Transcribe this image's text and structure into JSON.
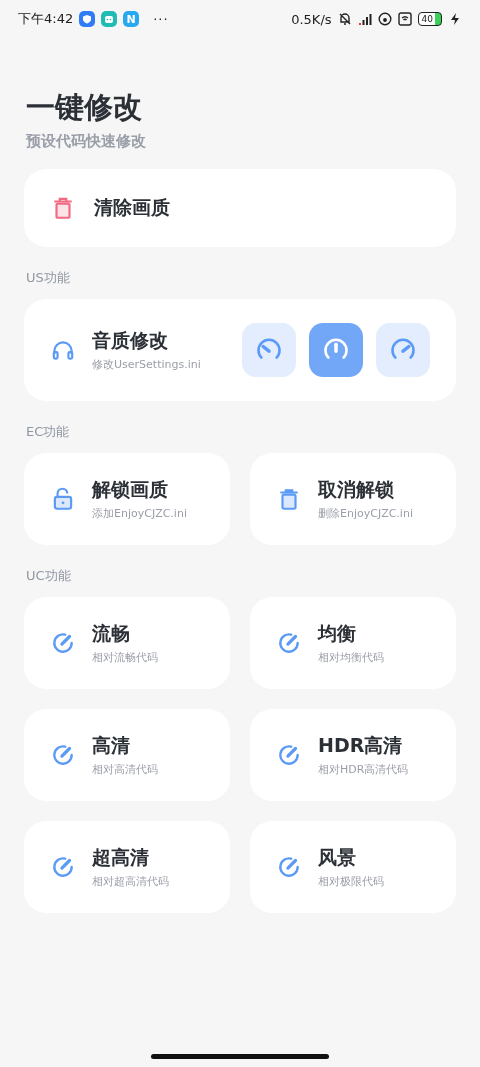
{
  "status_bar": {
    "time": "下午4:42",
    "apps": [
      {
        "color": "#2f7cf6",
        "kind": "shield"
      },
      {
        "color": "#1fbcb4",
        "kind": "bot"
      },
      {
        "color": "#27a8f0",
        "kind": "letter",
        "text": "N"
      }
    ],
    "more": "···",
    "speed": "0.5K/s",
    "battery": "40"
  },
  "header": {
    "title": "一键修改",
    "subtitle": "预设代码快速修改"
  },
  "clear_card": {
    "label": "清除画质"
  },
  "sections": [
    {
      "label": "US功能",
      "kind": "audio",
      "cards": [
        {
          "kind": "headphones",
          "title": "音质修改",
          "subtitle": "修改UserSettings.ini",
          "modes": [
            {
              "kind": "low",
              "selected": false
            },
            {
              "kind": "mid",
              "selected": true
            },
            {
              "kind": "high",
              "selected": false
            }
          ]
        }
      ]
    },
    {
      "label": "EC功能",
      "kind": "grid",
      "cards": [
        {
          "kind": "unlock",
          "title": "解锁画质",
          "subtitle": "添加EnjoyCJZC.ini"
        },
        {
          "kind": "trash",
          "title": "取消解锁",
          "subtitle": "删除EnjoyCJZC.ini"
        }
      ]
    },
    {
      "label": "UC功能",
      "kind": "grid",
      "cards": [
        {
          "kind": "edit",
          "title": "流畅",
          "subtitle": "相对流畅代码"
        },
        {
          "kind": "edit",
          "title": "均衡",
          "subtitle": "相对均衡代码"
        },
        {
          "kind": "edit",
          "title": "高清",
          "subtitle": "相对高清代码"
        },
        {
          "kind": "edit",
          "title": "HDR高清",
          "subtitle": "相对HDR高清代码"
        },
        {
          "kind": "edit",
          "title": "超高清",
          "subtitle": "相对超高清代码"
        },
        {
          "kind": "edit",
          "title": "风景",
          "subtitle": "相对极限代码"
        }
      ]
    }
  ]
}
